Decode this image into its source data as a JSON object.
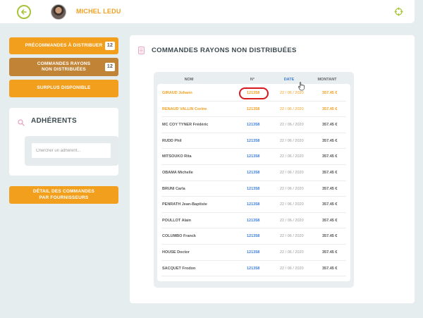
{
  "header": {
    "user_name": "MICHEL LEDU",
    "back_icon": "arrow-left-icon",
    "target_icon": "crosshair-icon"
  },
  "sidebar": {
    "btn_precommandes": {
      "label": "PRÉCOMMANDES À DISTRIBUER",
      "count": "12"
    },
    "btn_rayons": {
      "label": "COMMANDES RAYONS NON DISTRIBUÉES",
      "count": "12"
    },
    "btn_surplus": {
      "label": "SURPLUS DISPONIBLE"
    },
    "adherents": {
      "title": "ADHÉRENTS",
      "search_placeholder": "Chercher un adhérent..."
    },
    "btn_detail": {
      "label": "DÉTAIL DES COMMANDES PAR FOURNISSEURS"
    }
  },
  "main": {
    "title": "COMMANDES RAYONS NON DISTRIBUÉES",
    "columns": {
      "nom": "NOM",
      "num": "N°",
      "date": "DATE",
      "montant": "MONTANT"
    },
    "rows": [
      {
        "nom": "GIRAUD Johann",
        "num": "121358",
        "date": "22 / 06 / 2020",
        "montant": "357.45 €"
      },
      {
        "nom": "RENAUD VALLIN Corine",
        "num": "121358",
        "date": "22 / 06 / 2020",
        "montant": "357.45 €"
      },
      {
        "nom": "MC COY TYNER Frédéric",
        "num": "121358",
        "date": "22 / 06 / 2020",
        "montant": "357.45 €"
      },
      {
        "nom": "RUDD Phil",
        "num": "121358",
        "date": "22 / 06 / 2020",
        "montant": "357.45 €"
      },
      {
        "nom": "MITSOUKO Rita",
        "num": "121358",
        "date": "22 / 06 / 2020",
        "montant": "357.45 €"
      },
      {
        "nom": "OBAMA Michelle",
        "num": "121358",
        "date": "22 / 06 / 2020",
        "montant": "357.45 €"
      },
      {
        "nom": "BRUNI Carla",
        "num": "121358",
        "date": "22 / 06 / 2020",
        "montant": "357.45 €"
      },
      {
        "nom": "PENRATH Jean-Baptiste",
        "num": "121358",
        "date": "22 / 06 / 2020",
        "montant": "357.45 €"
      },
      {
        "nom": "POULLOT Alain",
        "num": "121358",
        "date": "22 / 06 / 2020",
        "montant": "357.45 €"
      },
      {
        "nom": "COLUMBO Franck",
        "num": "121358",
        "date": "22 / 06 / 2020",
        "montant": "357.45 €"
      },
      {
        "nom": "HOUSE Doctor",
        "num": "121358",
        "date": "22 / 06 / 2020",
        "montant": "357.45 €"
      },
      {
        "nom": "SACQUET Frodon",
        "num": "121358",
        "date": "22 / 06 / 2020",
        "montant": "357.45 €"
      }
    ]
  },
  "colors": {
    "accent": "#f29f1d",
    "brown": "#c18336",
    "green": "#a6c33a",
    "link": "#3f7fd6",
    "highlight_circle": "#d6181f"
  }
}
